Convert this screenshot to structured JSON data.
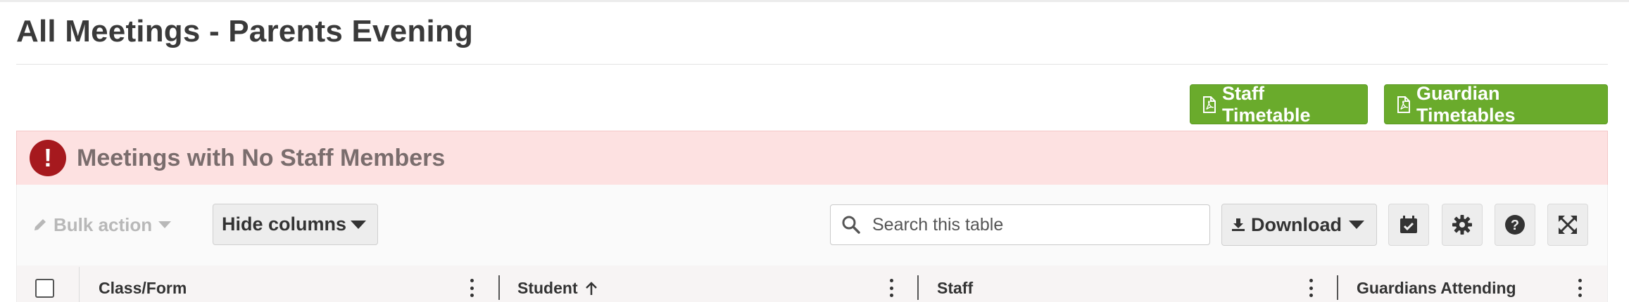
{
  "page": {
    "title": "All Meetings - Parents Evening"
  },
  "actions": {
    "staff_timetable": "Staff Timetable",
    "guardian_timetables": "Guardian Timetables"
  },
  "alert": {
    "message": "Meetings with No Staff Members",
    "icon": "exclamation-circle-icon",
    "color": "#a6191e"
  },
  "toolbar": {
    "bulk_action": "Bulk action",
    "hide_columns": "Hide columns",
    "search_placeholder": "Search this table",
    "download": "Download"
  },
  "table": {
    "columns": [
      {
        "label": "Class/Form"
      },
      {
        "label": "Student",
        "sort": "ascending"
      },
      {
        "label": "Staff"
      },
      {
        "label": "Guardians Attending"
      }
    ]
  },
  "colors": {
    "primary_green": "#6aab2c",
    "alert_background": "#fde1e1"
  }
}
